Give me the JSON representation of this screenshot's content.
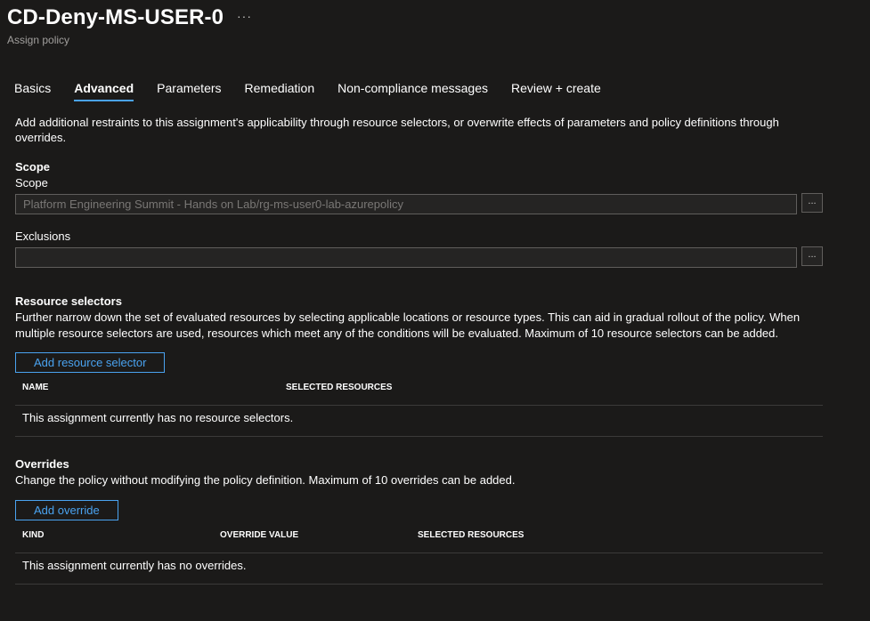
{
  "header": {
    "title": "CD-Deny-MS-USER-0",
    "more_icon": "···",
    "subtitle": "Assign policy"
  },
  "tabs": [
    {
      "label": "Basics",
      "active": false
    },
    {
      "label": "Advanced",
      "active": true
    },
    {
      "label": "Parameters",
      "active": false
    },
    {
      "label": "Remediation",
      "active": false
    },
    {
      "label": "Non-compliance messages",
      "active": false
    },
    {
      "label": "Review + create",
      "active": false
    }
  ],
  "description": "Add additional restraints to this assignment's applicability through resource selectors, or overwrite effects of parameters and policy definitions through overrides.",
  "scope": {
    "heading": "Scope",
    "label": "Scope",
    "value": "Platform Engineering Summit - Hands on Lab/rg-ms-user0-lab-azurepolicy",
    "browse": "..."
  },
  "exclusions": {
    "label": "Exclusions",
    "value": "",
    "browse": "..."
  },
  "resource_selectors": {
    "heading": "Resource selectors",
    "description": "Further narrow down the set of evaluated resources by selecting applicable locations or resource types. This can aid in gradual rollout of the policy. When multiple resource selectors are used, resources which meet any of the conditions will be evaluated. Maximum of 10 resource selectors can be added.",
    "add_button": "Add resource selector",
    "columns": [
      "NAME",
      "SELECTED RESOURCES"
    ],
    "empty_message": "This assignment currently has no resource selectors."
  },
  "overrides": {
    "heading": "Overrides",
    "description": "Change the policy without modifying the policy definition. Maximum of 10 overrides can be added.",
    "add_button": "Add override",
    "columns": [
      "KIND",
      "OVERRIDE VALUE",
      "SELECTED RESOURCES"
    ],
    "empty_message": "This assignment currently has no overrides."
  },
  "colors": {
    "background": "#1b1a19",
    "accent": "#4aa3f0",
    "border": "#605e5c"
  }
}
